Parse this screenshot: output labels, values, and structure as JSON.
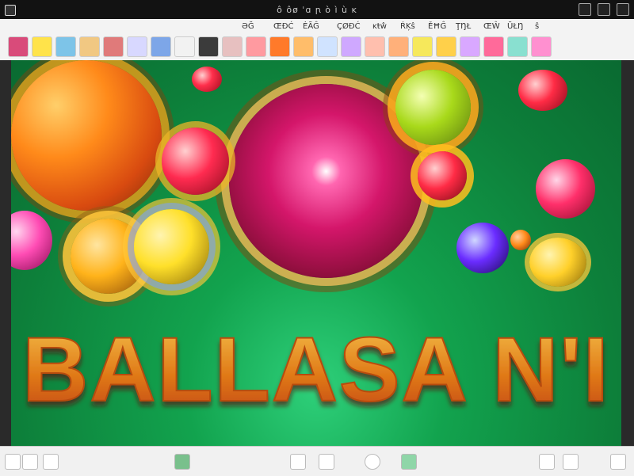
{
  "window": {
    "title": "ô ôø ˈɑ ꞃ ò ì ù ĸ"
  },
  "ribbon": {
    "tabs": [
      "ƏĞ",
      "ŒĐĆ",
      "ĖÃĜ",
      "ÇØĐĆ",
      "ĸŧŵ",
      "ŔĶŝ",
      "ĚĦĜ",
      "ŢŊŁ",
      "ŒŴ",
      "ŨŁŊ",
      "ŝ"
    ],
    "tool_colors": [
      "#d94b7a",
      "#ffe34a",
      "#7dc4e8",
      "#f1c882",
      "#e07a7a",
      "#d8d8ff",
      "#7da6e8",
      "#f2f2f2",
      "#3b3b3b",
      "#e7c0c0",
      "#ff9aa0",
      "#ff7a2a",
      "#ffbd6a",
      "#d0e3ff",
      "#cfa8ff",
      "#ffbfae",
      "#ffb07a",
      "#f6e85b",
      "#ffd04a",
      "#d9a8ff",
      "#ff6a9a",
      "#89e0d0",
      "#ff90d0"
    ]
  },
  "canvas": {
    "headline_text": "BALLASA N'I",
    "accent": "#e07a18"
  },
  "status": {
    "zoom": "",
    "page": ""
  }
}
